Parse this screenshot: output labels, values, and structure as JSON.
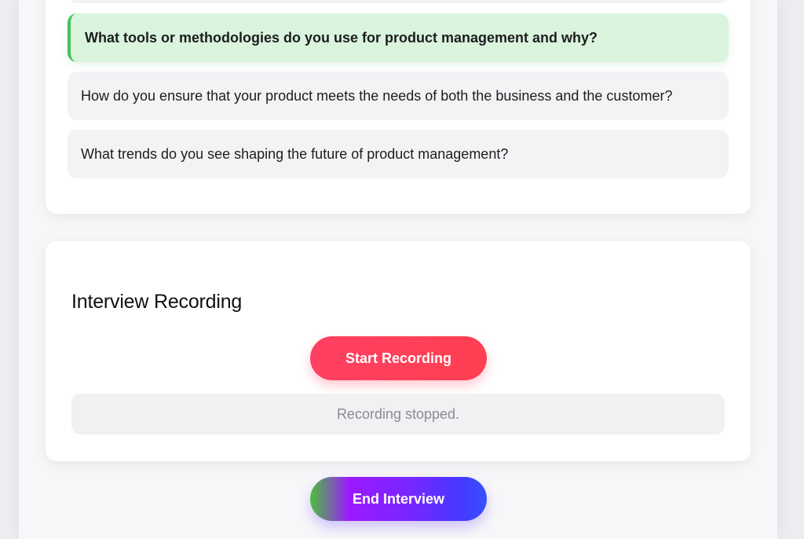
{
  "questions": {
    "items": [
      {
        "text": "What tools or methodologies do you use for product management and why?",
        "active": true
      },
      {
        "text": "How do you ensure that your product meets the needs of both the business and the customer?",
        "active": false
      },
      {
        "text": "What trends do you see shaping the future of product management?",
        "active": false
      }
    ]
  },
  "recording": {
    "title": "Interview Recording",
    "start_label": "Start Recording",
    "status": "Recording stopped."
  },
  "actions": {
    "end_label": "End Interview"
  },
  "colors": {
    "active_question_bg": "#daf4dd",
    "active_question_accent": "#43c160",
    "record_button": "#ff4062",
    "end_button_start": "#9b1aff",
    "end_button_end": "#3651ff"
  }
}
